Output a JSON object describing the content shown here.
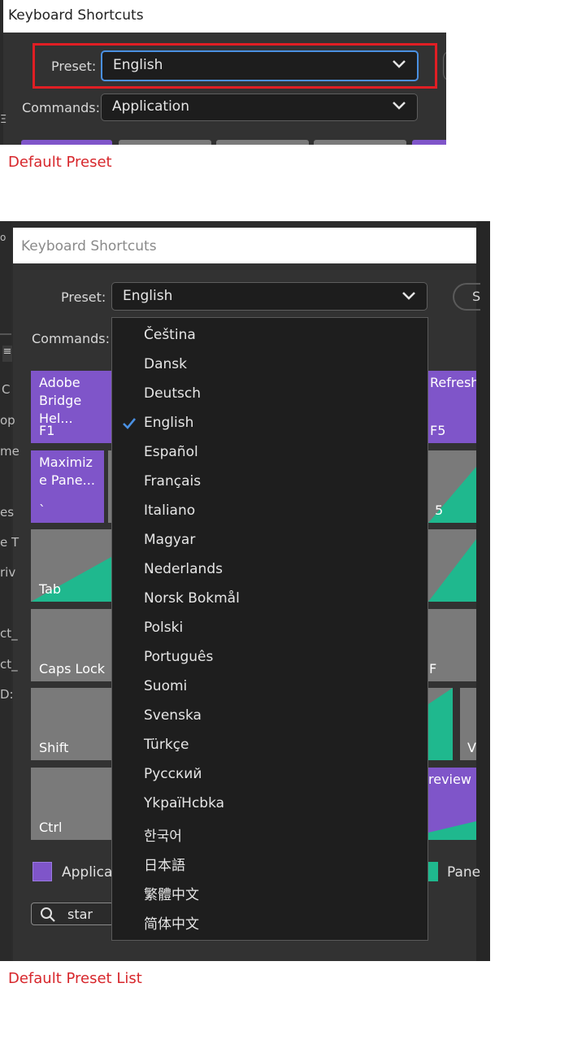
{
  "panel1": {
    "title": "Keyboard Shortcuts",
    "preset_label": "Preset:",
    "preset_value": "English",
    "commands_label": "Commands:",
    "commands_value": "Application",
    "caption": "Default Preset"
  },
  "panel2": {
    "title": "Keyboard Shortcuts",
    "preset_label": "Preset:",
    "preset_value": "English",
    "commands_label": "Commands:",
    "side_fragments": [
      "C",
      "op",
      "me",
      "es",
      "e T",
      "riv",
      "ct_",
      "ct_",
      "D:"
    ],
    "keys": {
      "adobe_bridge_name": "Adobe Bridge Hel...",
      "adobe_bridge_sc": "F1",
      "refresh_name": "Refresh",
      "refresh_sc": "F5",
      "maximize_name": "Maximiz e Pane...",
      "maximize_sc": "`",
      "five_sc": "5",
      "tab_label": "Tab",
      "caps_lock_label": "Caps Lock",
      "f_label": "F",
      "shift_label": "Shift",
      "v_label": "V",
      "ctrl_label": "Ctrl",
      "preview_name": "review"
    },
    "legend_application": "Applicati",
    "legend_panel": "Pane",
    "search_value": "star",
    "menu_items": [
      "Čeština",
      "Dansk",
      "Deutsch",
      "English",
      "Español",
      "Français",
      "Italiano",
      "Magyar",
      "Nederlands",
      "Norsk Bokmål",
      "Polski",
      "Português",
      "Suomi",
      "Svenska",
      "Türkçe",
      "Русский",
      "YkpaїHcbka",
      "한국어",
      "日本語",
      "繁體中文",
      "简体中文"
    ],
    "menu_selected": "English",
    "caption": "Default Preset List"
  },
  "colors": {
    "application_swatch": "#7f55c9",
    "panel_swatch": "#1fb88e",
    "caption": "#d7262b",
    "focus_ring": "#4a90e2",
    "highlight_box": "#e01e24"
  }
}
